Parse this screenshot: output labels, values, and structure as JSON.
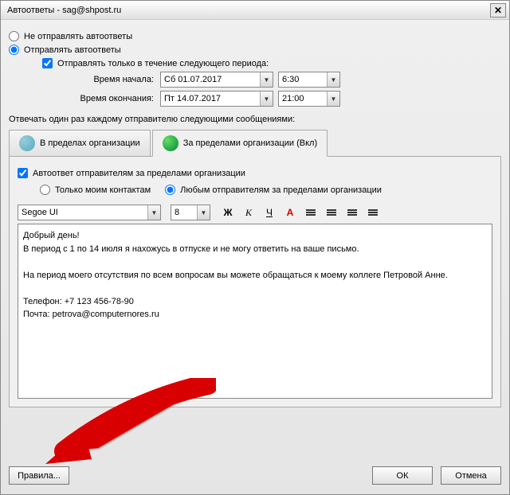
{
  "titlebar": {
    "title": "Автоответы - sag@shpost.ru",
    "close": "✕"
  },
  "radios": {
    "dont_send": "Не отправлять автоответы",
    "send": "Отправлять автоответы"
  },
  "period": {
    "check_label": "Отправлять только в течение следующего периода:",
    "start_label": "Время начала:",
    "end_label": "Время окончания:",
    "start_date": "Сб 01.07.2017",
    "start_time": "6:30",
    "end_date": "Пт 14.07.2017",
    "end_time": "21:00"
  },
  "reply_section": "Отвечать один раз каждому отправителю следующими сообщениями:",
  "tabs": {
    "inside": "В пределах организации",
    "outside": "За пределами организации (Вкл)"
  },
  "outside_opts": {
    "enable": "Автоответ отправителям за пределами организации",
    "my_contacts": "Только моим контактам",
    "any": "Любым отправителям за пределами организации"
  },
  "toolbar": {
    "font": "Segoe UI",
    "size": "8",
    "bold": "Ж",
    "italic": "K",
    "underline": "Ч",
    "color": "A"
  },
  "message": "Добрый день!\nВ период с 1 по 14 июля я нахожусь в отпуске и не могу ответить на ваше письмо.\n\nНа период моего отсутствия по всем вопросам вы можете обращаться к моему коллеге Петровой Анне.\n\nТелефон: +7 123 456-78-90\nПочта: petrova@computernores.ru",
  "buttons": {
    "rules": "Правила...",
    "ok": "ОК",
    "cancel": "Отмена"
  }
}
